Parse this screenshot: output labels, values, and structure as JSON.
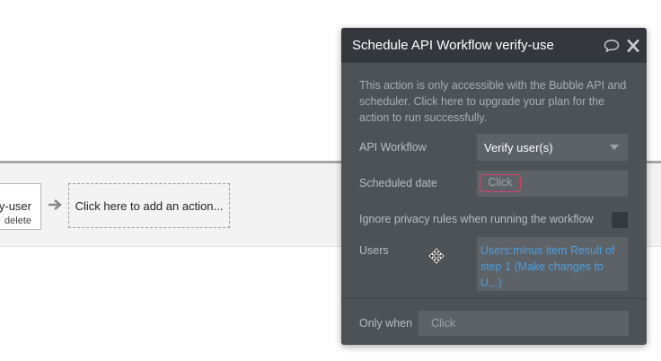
{
  "workflow": {
    "event_title": "fy-user",
    "event_delete": "delete",
    "add_action": "Click here to add an action..."
  },
  "panel": {
    "title": "Schedule API Workflow verify-use",
    "note": "This action is only accessible with the Bubble API and scheduler. Click here to upgrade your plan for the action to run successfully.",
    "api_workflow": {
      "label": "API Workflow",
      "value": "Verify user(s)"
    },
    "scheduled_date": {
      "label": "Scheduled date",
      "value": "Click"
    },
    "ignore_privacy": {
      "label": "Ignore privacy rules when running the workflow",
      "checked": false
    },
    "users": {
      "label": "Users",
      "value": "Users:minus item Result of step 1 (Make changes to U...)"
    },
    "only_when": {
      "label": "Only when",
      "placeholder": "Click"
    }
  },
  "colors": {
    "panel_bg": "#4d5257",
    "header_bg": "#34383c",
    "link_blue": "#4a9ee0",
    "highlight_pink": "#e0406a"
  },
  "icons": {
    "comment": "comment-icon",
    "close": "close-icon",
    "dropdown": "chevron-down-icon",
    "arrow": "arrow-right-icon",
    "cursor": "move-cursor-icon"
  }
}
